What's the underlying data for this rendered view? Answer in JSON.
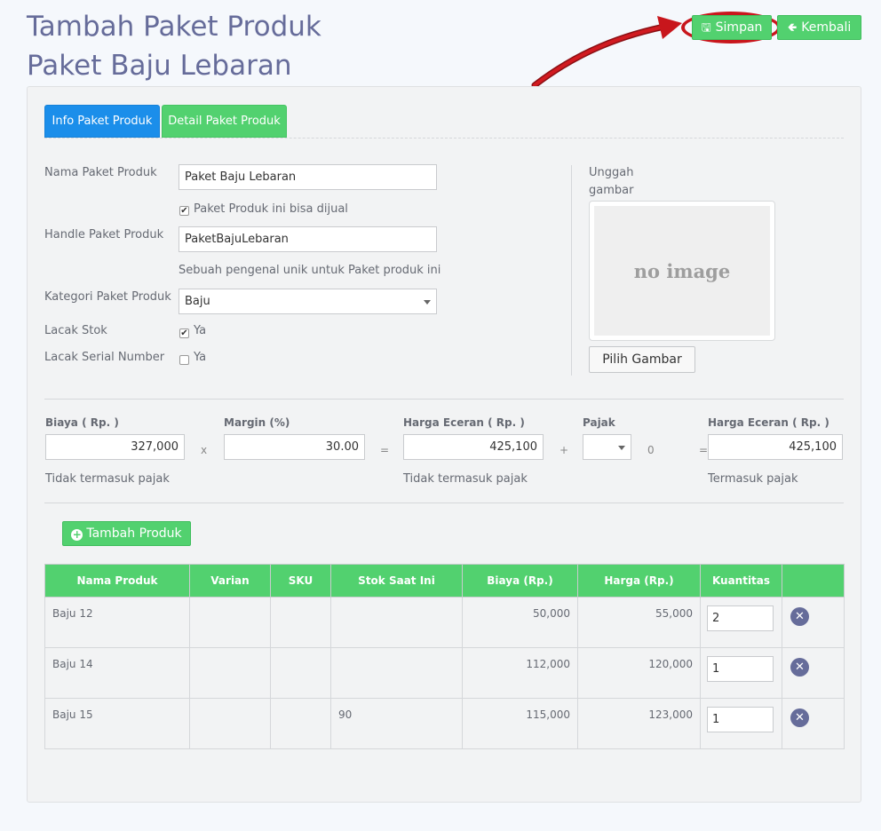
{
  "page": {
    "title_line1": "Tambah Paket Produk",
    "title_line2": "Paket Baju Lebaran"
  },
  "header": {
    "save_label": "Simpan",
    "back_label": "Kembali",
    "save_icon": "floppy-disk-icon",
    "back_icon": "arrow-left-icon"
  },
  "tabs": [
    {
      "label": "Info Paket Produk",
      "active": true
    },
    {
      "label": "Detail Paket Produk",
      "active": false
    }
  ],
  "form": {
    "name_label": "Nama Paket Produk",
    "name_value": "Paket Baju Lebaran",
    "sellable_label": "Paket Produk ini bisa dijual",
    "sellable_checked": true,
    "handle_label": "Handle Paket Produk",
    "handle_value": "PaketBajuLebaran",
    "handle_help": "Sebuah pengenal unik untuk Paket produk ini",
    "category_label": "Kategori Paket Produk",
    "category_value": "Baju",
    "track_stock_label": "Lacak Stok",
    "track_stock_option": "Ya",
    "track_stock_checked": true,
    "track_serial_label": "Lacak Serial Number",
    "track_serial_option": "Ya",
    "track_serial_checked": false
  },
  "image": {
    "upload_label_1": "Unggah",
    "upload_label_2": "gambar",
    "placeholder": "no image",
    "choose_label": "Pilih Gambar"
  },
  "pricing": {
    "cost_label": "Biaya ( Rp. )",
    "cost_value": "327,000",
    "cost_note": "Tidak termasuk pajak",
    "op_x": "x",
    "margin_label": "Margin (%)",
    "margin_value": "30.00",
    "op_eq1": "=",
    "retail_label": "Harga Eceran ( Rp. )",
    "retail_value": "425,100",
    "retail_note": "Tidak termasuk pajak",
    "op_plus": "+",
    "tax_label": "Pajak",
    "tax_amount": "0",
    "op_eq2": "=",
    "retail_tax_label": "Harga Eceran ( Rp. )",
    "retail_tax_value": "425,100",
    "retail_tax_note": "Termasuk pajak"
  },
  "products": {
    "add_label": "Tambah Produk",
    "columns": [
      "Nama Produk",
      "Varian",
      "SKU",
      "Stok Saat Ini",
      "Biaya (Rp.)",
      "Harga (Rp.)",
      "Kuantitas",
      ""
    ],
    "rows": [
      {
        "name": "Baju 12",
        "variant": "",
        "sku": "",
        "stock": "",
        "cost": "50,000",
        "price": "55,000",
        "qty": "2"
      },
      {
        "name": "Baju 14",
        "variant": "",
        "sku": "",
        "stock": "",
        "cost": "112,000",
        "price": "120,000",
        "qty": "1"
      },
      {
        "name": "Baju 15",
        "variant": "",
        "sku": "",
        "stock": "90",
        "cost": "115,000",
        "price": "123,000",
        "qty": "1"
      }
    ]
  },
  "colors": {
    "title": "#666c9a",
    "green": "#52d16f",
    "blue_tab": "#1b8eea",
    "annotation_red": "#c8161c"
  }
}
